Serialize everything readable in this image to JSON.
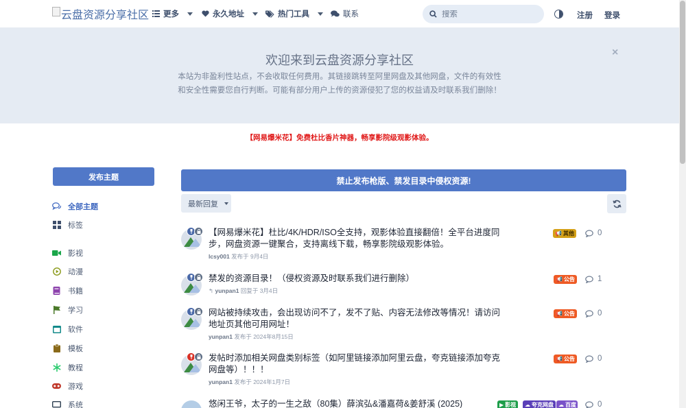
{
  "header": {
    "logo_alt": "云盘资源分享社区",
    "nav": [
      {
        "label": "更多",
        "icon": "list-icon"
      },
      {
        "label": "永久地址",
        "icon": "heart-icon"
      },
      {
        "label": "热门工具",
        "icon": "tags-icon"
      },
      {
        "label": "联系",
        "icon": "comments-icon"
      }
    ],
    "search_placeholder": "搜索",
    "register": "注册",
    "login": "登录"
  },
  "hero": {
    "title": "欢迎来到云盘资源分享社区",
    "description": "本站为非盈利性站点，不会收取任何费用。其链接跳转至阿里网盘及其他网盘，文件的有效性和安全性需要您自行判断。可能有部分用户上传的资源侵犯了您的权益请及时联系我们删除！",
    "close": "×"
  },
  "notice": "【网易爆米花】免费杜比香片神器，畅享影院级观影体验。",
  "sidebar": {
    "start_button": "发布主题",
    "items": [
      {
        "label": "全部主题",
        "color": "#3f68c0"
      },
      {
        "label": "标签",
        "color": "#3e4f6c"
      },
      {
        "label": "影视",
        "color": "#1aa64a"
      },
      {
        "label": "动漫",
        "color": "#8a9a1a"
      },
      {
        "label": "书籍",
        "color": "#8e44ad"
      },
      {
        "label": "学习",
        "color": "#4b7a2a"
      },
      {
        "label": "软件",
        "color": "#138a8a"
      },
      {
        "label": "模板",
        "color": "#8a6a1a"
      },
      {
        "label": "教程",
        "color": "#2ecc71"
      },
      {
        "label": "游戏",
        "color": "#c0392b"
      },
      {
        "label": "系统",
        "color": "#2c3e50"
      }
    ]
  },
  "main": {
    "banner": "禁止发布枪版、禁发目录中侵权资源!",
    "sort_label": "最新回复",
    "posts": [
      {
        "title": "【网易爆米花】杜比/4K/HDR/ISO全支持，观影体验直接翻倍！全平台进度同步，网盘资源一键聚合，支持离线下载，畅享影院级观影体验。",
        "author": "lcsy001",
        "meta": "发布于 9月4日",
        "tags": [
          {
            "label": "其他",
            "color": "#d4a017",
            "text": "#3b2a00"
          }
        ],
        "replies": "0"
      },
      {
        "title": "禁发的资源目录！（侵权资源及时联系我们进行删除）",
        "author": "yunpan1",
        "meta": "回复于 3月4日",
        "tags": [
          {
            "label": "公告",
            "color": "#ee5a24",
            "text": "#ffffff"
          }
        ],
        "replies": "1"
      },
      {
        "title": "网站被持续攻击，会出现访问不了，发不了贴、内容无法修改等情况！请访问地址页其他可用网址！",
        "author": "yunpan1",
        "meta": "发布于 2024年8月15日",
        "tags": [
          {
            "label": "公告",
            "color": "#ee5a24",
            "text": "#ffffff"
          }
        ],
        "replies": "0"
      },
      {
        "title": "发帖时添加相关网盘类别标签（如阿里链接添加阿里云盘，夸克链接添加夸克网盘等）！！！",
        "author": "yunpan1",
        "meta": "发布于 2024年1月7日",
        "tags": [
          {
            "label": "公告",
            "color": "#ee5a24",
            "text": "#ffffff"
          }
        ],
        "replies": "0"
      },
      {
        "title": "悠闲王爷，太子的一生之敌（80集）薛滨弘&潘嘉荷&姜舒溪 (2025)",
        "author": "",
        "meta": "",
        "tags": [
          {
            "label": "影视",
            "color": "#1e9e4a",
            "text": "#ffffff"
          },
          {
            "label": "夸克网盘",
            "color": "#5a3fb8",
            "text": "#ffffff"
          },
          {
            "label": "百度",
            "color": "#7a52c9",
            "text": "#ffffff"
          }
        ],
        "replies": "0"
      }
    ]
  }
}
